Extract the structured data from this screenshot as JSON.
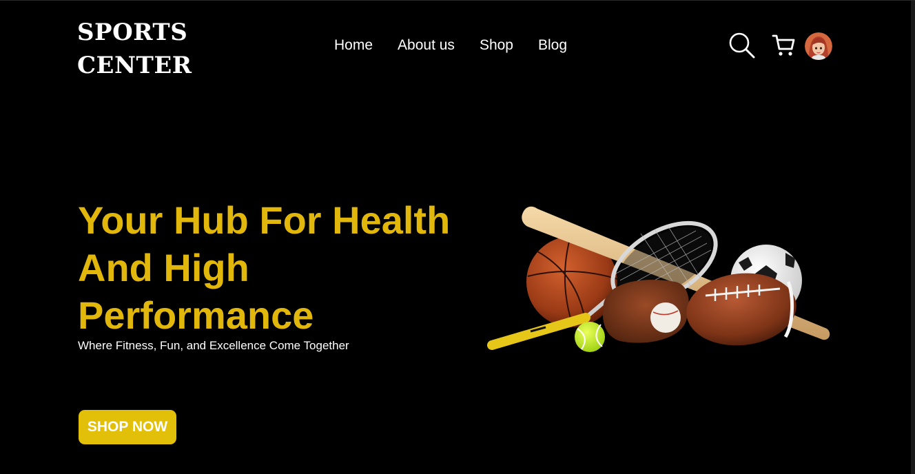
{
  "header": {
    "logo_line1": "SPORTS",
    "logo_line2": "CENTER",
    "nav": [
      {
        "label": "Home"
      },
      {
        "label": "About us"
      },
      {
        "label": "Shop"
      },
      {
        "label": "Blog"
      }
    ],
    "icons": {
      "search": "search-icon",
      "cart": "cart-icon",
      "avatar": "user-avatar"
    }
  },
  "hero": {
    "title_line1": "Your Hub For Health",
    "title_line2": "And High",
    "title_line3": "Performance",
    "subtitle": "Where Fitness, Fun, and Excellence Come Together",
    "cta_label": "SHOP NOW"
  },
  "colors": {
    "background": "#000000",
    "accent": "#e2b70b",
    "button": "#e2bf09",
    "text": "#ffffff"
  }
}
